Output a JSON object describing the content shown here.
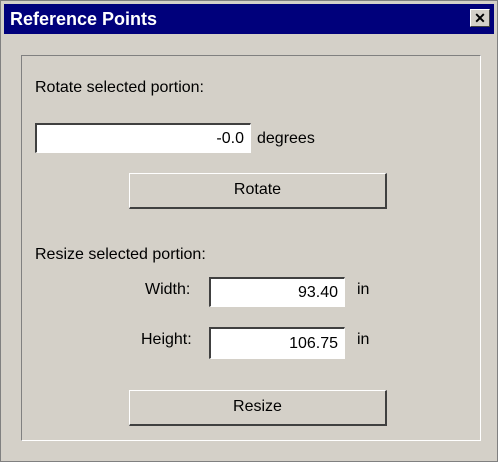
{
  "window": {
    "title": "Reference Points",
    "close_glyph": "✕",
    "close_icon": "close-icon"
  },
  "rotate": {
    "section_label": "Rotate selected portion:",
    "value": "-0.0",
    "unit": "degrees",
    "button_label": "Rotate"
  },
  "resize": {
    "section_label": "Resize selected portion:",
    "width_label": "Width:",
    "width_value": "93.40",
    "width_unit": "in",
    "height_label": "Height:",
    "height_value": "106.75",
    "height_unit": "in",
    "button_label": "Resize"
  },
  "colors": {
    "titlebar": "#00007b",
    "face": "#d4d0c8"
  }
}
